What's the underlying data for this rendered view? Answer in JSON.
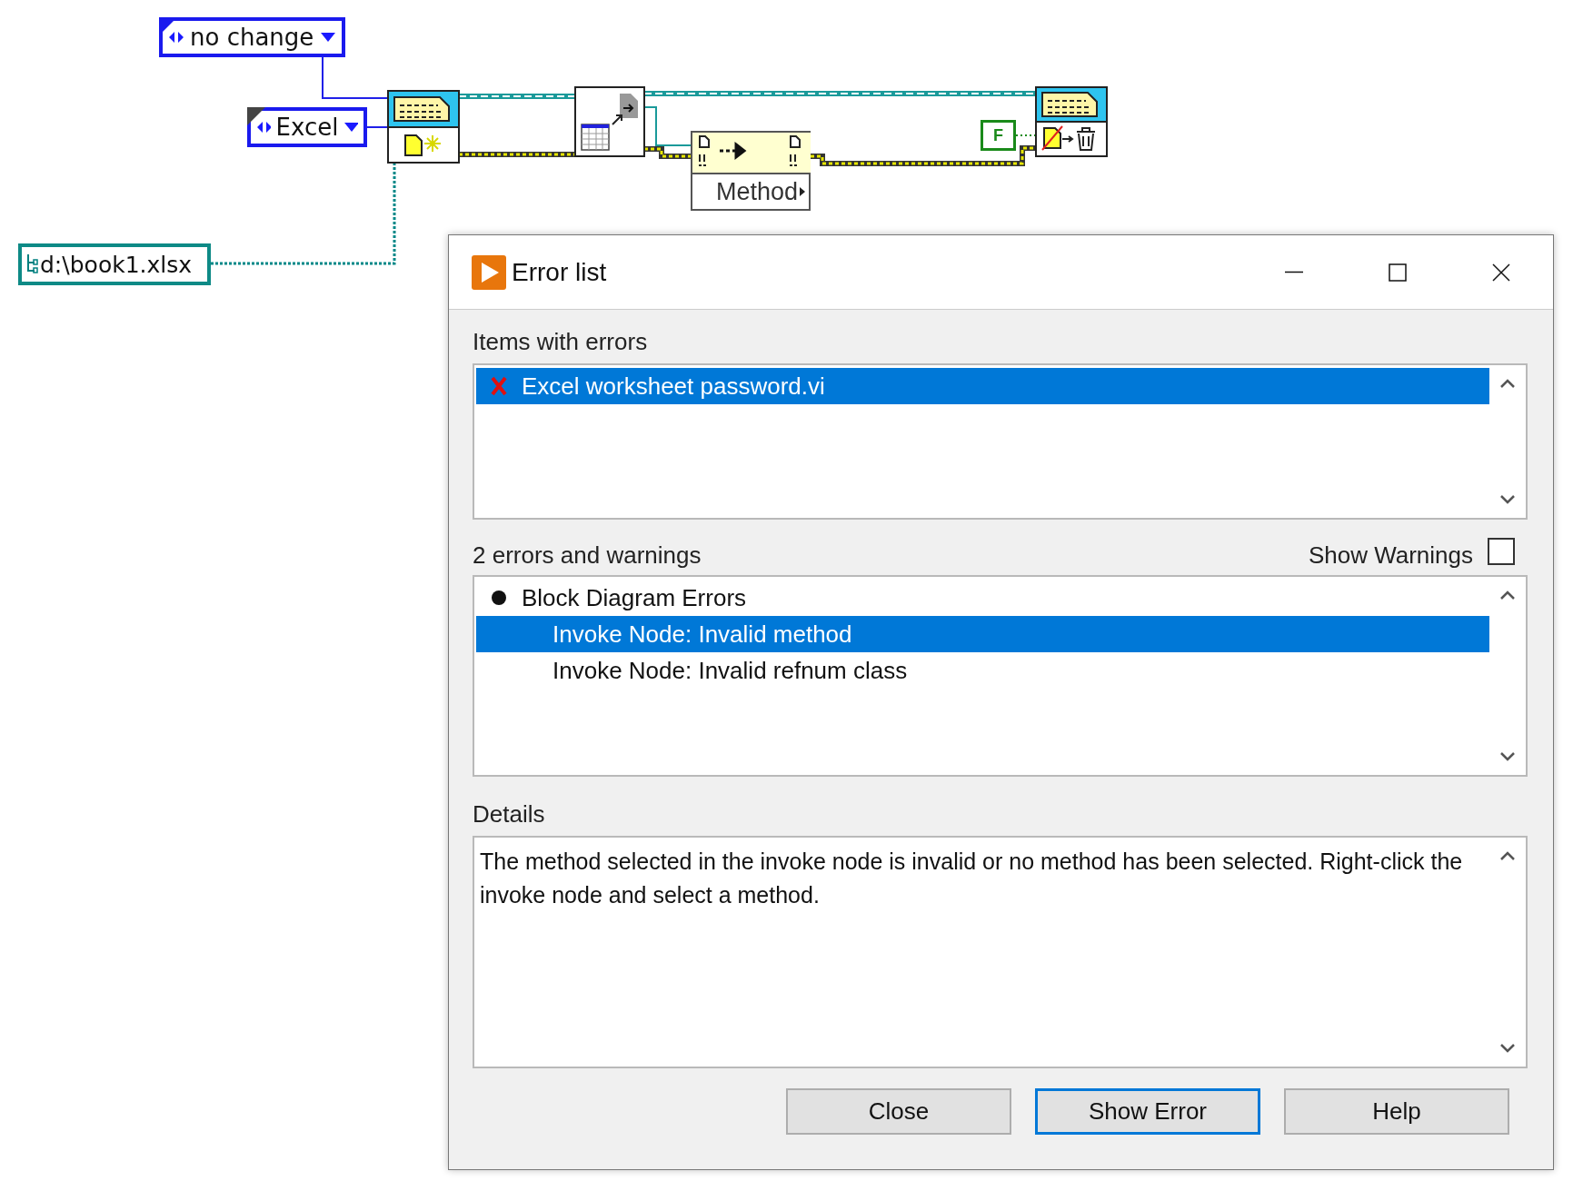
{
  "diagram": {
    "enums": [
      {
        "text": "no change",
        "label_hidden": false
      },
      {
        "text": "Excel",
        "label_hidden": true
      }
    ],
    "path_constant": "d:\\book1.xlsx",
    "invoke_node": {
      "method": "Method"
    },
    "boolean_constant": "F"
  },
  "dialog": {
    "title": "Error list",
    "items_label": "Items with errors",
    "items": [
      {
        "name": "Excel worksheet password.vi",
        "selected": true
      }
    ],
    "count_label": "2 errors and warnings",
    "show_warnings": {
      "label": "Show Warnings",
      "checked": false
    },
    "errors": [
      {
        "label": "Block Diagram Errors",
        "selected": false,
        "children": [
          {
            "label": "Invoke Node: Invalid method",
            "selected": true
          },
          {
            "label": "Invoke Node: Invalid refnum class",
            "selected": false
          }
        ]
      }
    ],
    "details_label": "Details",
    "details": "The method selected in the invoke node is invalid or no method has been selected. Right-click the invoke node and select a method.",
    "buttons": [
      {
        "label": "Close",
        "default": false
      },
      {
        "label": "Show Error",
        "default": true
      },
      {
        "label": "Help",
        "default": false
      }
    ]
  }
}
